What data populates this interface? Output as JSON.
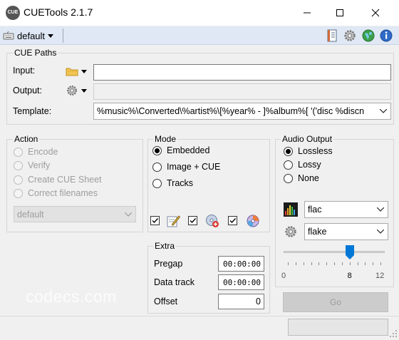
{
  "window": {
    "title": "CUETools 2.1.7",
    "app_icon_text": "CUE"
  },
  "toolbar": {
    "profile": "default"
  },
  "cue_paths": {
    "label": "CUE Paths",
    "input_label": "Input:",
    "input_value": "",
    "output_label": "Output:",
    "output_value": "",
    "template_label": "Template:",
    "template_value": "%music%\\Converted\\%artist%\\[%year% - ]%album%[ '('disc %discn"
  },
  "action": {
    "label": "Action",
    "options": [
      "Encode",
      "Verify",
      "Create CUE Sheet",
      "Correct filenames"
    ],
    "selected": "Encode",
    "dropdown_value": "default"
  },
  "mode": {
    "label": "Mode",
    "options": [
      "Embedded",
      "Image + CUE",
      "Tracks"
    ],
    "selected": "Embedded"
  },
  "audio_output": {
    "label": "Audio Output",
    "options": [
      "Lossless",
      "Lossy",
      "None"
    ],
    "selected": "Lossless",
    "format": "flac",
    "encoder": "flake",
    "slider": {
      "min_label": "0",
      "value_label": "8",
      "max_label": "12",
      "value": 8,
      "min": 0,
      "max": 12
    }
  },
  "extra": {
    "label": "Extra",
    "pregap_label": "Pregap",
    "pregap_value": "00:00:00",
    "data_track_label": "Data track",
    "data_track_value": "00:00:00",
    "offset_label": "Offset",
    "offset_value": "0"
  },
  "go_button": "Go",
  "watermark": "codecs.com"
}
